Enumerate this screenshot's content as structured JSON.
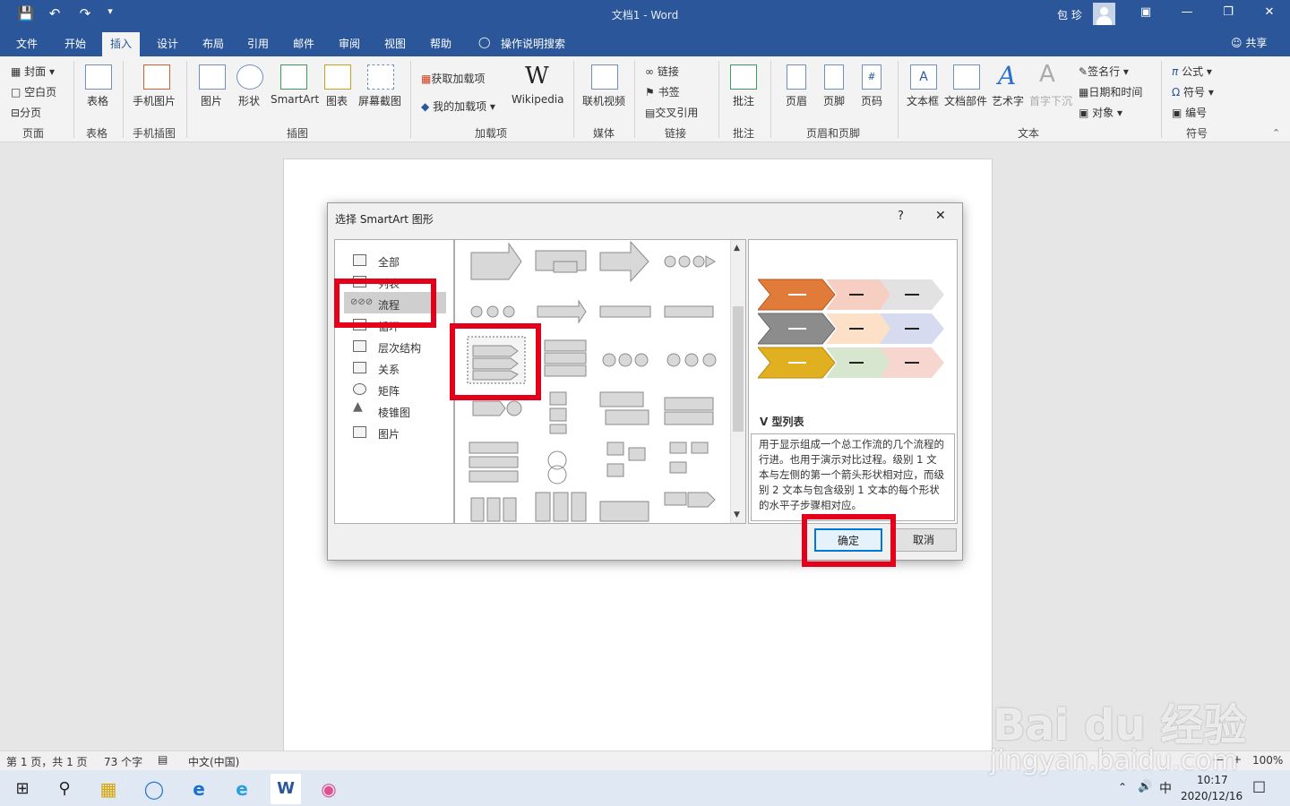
{
  "window": {
    "title": "文档1  -  Word",
    "user": "包 珍"
  },
  "menu": {
    "tabs": [
      "文件",
      "开始",
      "插入",
      "设计",
      "布局",
      "引用",
      "邮件",
      "审阅",
      "视图",
      "帮助"
    ],
    "active": "插入",
    "tellme": "操作说明搜索",
    "share": "共享"
  },
  "ribbon": {
    "pages": {
      "cover": "封面",
      "blank": "空白页",
      "break": "分页",
      "group": "页面"
    },
    "table": {
      "label": "表格",
      "group": "表格"
    },
    "phone": {
      "label": "手机图片",
      "group": "手机插图"
    },
    "illus": {
      "pic": "图片",
      "shape": "形状",
      "smartart": "SmartArt",
      "chart": "图表",
      "screenshot": "屏幕截图",
      "group": "插图"
    },
    "addins": {
      "get": "获取加载项",
      "mine": "我的加载项",
      "wiki": "Wikipedia",
      "group": "加载项"
    },
    "media": {
      "video": "联机视频",
      "group": "媒体"
    },
    "links": {
      "link": "链接",
      "bookmark": "书签",
      "xref": "交叉引用",
      "group": "链接"
    },
    "comments": {
      "comment": "批注",
      "group": "批注"
    },
    "hf": {
      "header": "页眉",
      "footer": "页脚",
      "pagenum": "页码",
      "group": "页眉和页脚"
    },
    "text": {
      "textbox": "文本框",
      "parts": "文档部件",
      "wordart": "艺术字",
      "dropcap": "首字下沉",
      "sig": "签名行",
      "date": "日期和时间",
      "object": "对象",
      "group": "文本"
    },
    "symbols": {
      "eq": "公式",
      "symbol": "符号",
      "number": "编号",
      "group": "符号"
    }
  },
  "dialog": {
    "title": "选择 SmartArt 图形",
    "help": "?",
    "categories": [
      "全部",
      "列表",
      "流程",
      "循环",
      "层次结构",
      "关系",
      "矩阵",
      "棱锥图",
      "图片"
    ],
    "selected_category": "流程",
    "preview_title": "V 型列表",
    "description": "用于显示组成一个总工作流的几个流程的行进。也用于演示对比过程。级别 1 文本与左侧的第一个箭头形状相对应，而级别 2 文本与包含级别 1 文本的每个形状的水平子步骤相对应。",
    "ok": "确定",
    "cancel": "取消"
  },
  "status": {
    "page": "第 1 页，共 1 页",
    "words": "73 个字",
    "lang": "中文(中国)",
    "zoom": "100%"
  },
  "taskbar": {
    "time": "10:17",
    "date": "2020/12/16",
    "ime": "中"
  },
  "watermark": {
    "line1": "Bai du 经验",
    "line2": "jingyan.baidu.com"
  },
  "colors": {
    "word_blue": "#2b579a",
    "highlight_red": "#e4001b",
    "accent1": "#e07b39",
    "accent2": "#8c8c8c",
    "accent3": "#e0b020"
  }
}
